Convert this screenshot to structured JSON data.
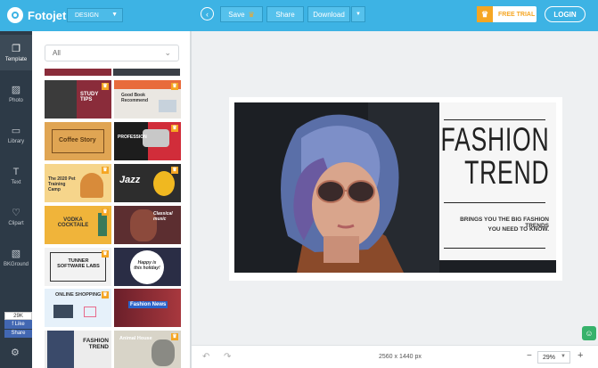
{
  "app": {
    "name": "Fotojet",
    "mode": "DESIGN"
  },
  "toolbar": {
    "save_label": "Save",
    "share_label": "Share",
    "download_label": "Download",
    "trial_label": "FREE TRIAL",
    "login_label": "LOGIN"
  },
  "sidebar": {
    "items": [
      {
        "label": "Template",
        "icon": "template-icon"
      },
      {
        "label": "Photo",
        "icon": "photo-icon"
      },
      {
        "label": "Library",
        "icon": "library-icon"
      },
      {
        "label": "Text",
        "icon": "text-icon"
      },
      {
        "label": "Clipart",
        "icon": "heart-icon"
      },
      {
        "label": "BKGround",
        "icon": "background-icon"
      }
    ],
    "fb_count": "29K",
    "fb_like": "Like",
    "fb_share": "Share"
  },
  "templates": {
    "filter": "All",
    "items": [
      {
        "text": "STUDY TIPS"
      },
      {
        "text": "Good Book Recommend"
      },
      {
        "text": "Coffee Story"
      },
      {
        "text": "PROFESSION"
      },
      {
        "text": "The 2020 Pet Training Camp"
      },
      {
        "text": "Jazz"
      },
      {
        "text": "VODKA COCKTAILE"
      },
      {
        "text": "Classical music"
      },
      {
        "text": "TUNNER SOFTWARE LABS"
      },
      {
        "text": "Happy is this holiday!"
      },
      {
        "text": "ONLINE SHOPPING"
      },
      {
        "text": "Fashion News"
      },
      {
        "text": "FASHION TREND"
      },
      {
        "text": "Animal House"
      }
    ]
  },
  "canvas": {
    "title_line1": "FASHION",
    "title_line2": "TREND",
    "subtitle_line1": "BRINGS YOU THE BIG FASHION TRENDS",
    "subtitle_line2": "YOU NEED TO KNOW."
  },
  "bottom": {
    "dimensions": "2560 x 1440 px",
    "zoom": "29%"
  }
}
